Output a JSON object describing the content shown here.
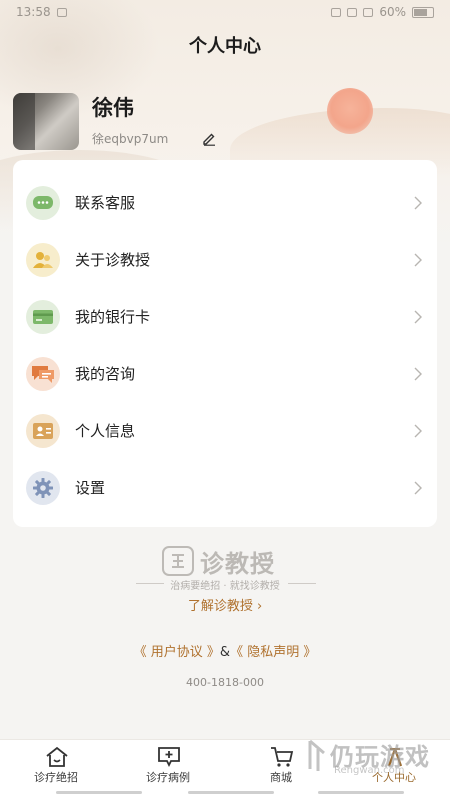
{
  "status_bar": {
    "time": "13:58",
    "battery": "60%"
  },
  "page_title": "个人中心",
  "profile": {
    "name": "徐伟",
    "user_id": "徐eqbvp7um"
  },
  "menu": [
    {
      "label": "联系客服",
      "icon": "chat-icon",
      "color": "#7db86a"
    },
    {
      "label": "关于诊教授",
      "icon": "people-icon",
      "color": "#e3b13a"
    },
    {
      "label": "我的银行卡",
      "icon": "bank-card-icon",
      "color": "#7db86a"
    },
    {
      "label": "我的咨询",
      "icon": "consult-icon",
      "color": "#e07a3f"
    },
    {
      "label": "个人信息",
      "icon": "id-card-icon",
      "color": "#d9a35a"
    },
    {
      "label": "设置",
      "icon": "gear-icon",
      "color": "#7f93b8"
    }
  ],
  "brand": {
    "name": "诊教授",
    "slogan": "治病要绝招 · 就找诊教授",
    "learn_more": "了解诊教授 ›"
  },
  "agreements": {
    "user_agreement": "《 用户协议 》",
    "amp": "&",
    "privacy": "《 隐私声明 》"
  },
  "phone": "400-1818-000",
  "tabs": [
    {
      "label": "诊疗绝招",
      "icon": "house-icon"
    },
    {
      "label": "诊疗病例",
      "icon": "case-icon"
    },
    {
      "label": "商城",
      "icon": "cart-icon"
    },
    {
      "label": "个人中心",
      "icon": "person-icon",
      "active": true
    }
  ],
  "watermark": {
    "text": "仍玩游戏",
    "sub": "Rengwan.com"
  },
  "colors": {
    "accent": "#b0722f",
    "background": "#f5f4f2",
    "card": "#ffffff"
  }
}
